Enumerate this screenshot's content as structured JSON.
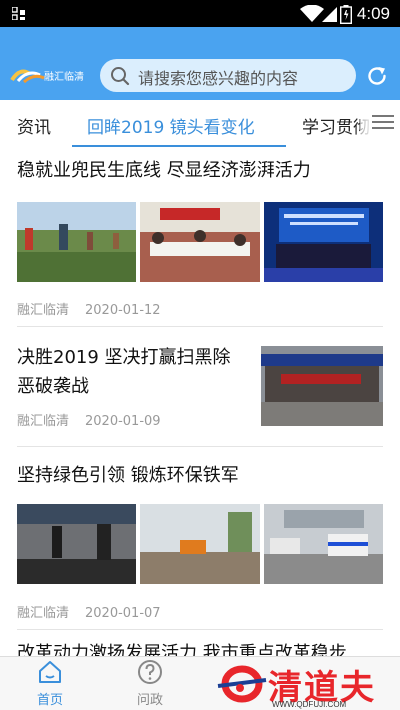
{
  "status_bar": {
    "time": "4:09"
  },
  "header": {
    "logo_text": "融汇临清",
    "search_placeholder": "请搜索您感兴趣的内容"
  },
  "tabs": [
    {
      "label": "资讯"
    },
    {
      "label": "回眸2019 镜头看变化"
    },
    {
      "label": "学习贯彻"
    }
  ],
  "articles": [
    {
      "title": "稳就业兜民生底线 尽显经济澎湃活力",
      "source": "融汇临清",
      "date": "2020-01-12"
    },
    {
      "title_line1": "决胜2019 坚决打赢扫黑除",
      "title_line2": "恶破袭战",
      "source": "融汇临清",
      "date": "2020-01-09"
    },
    {
      "title": "坚持绿色引领 锻炼环保铁军",
      "source": "融汇临清",
      "date": "2020-01-07"
    },
    {
      "title": "改革动力激扬发展活力 我市重点改革稳步"
    }
  ],
  "bottom_nav": [
    {
      "label": "首页",
      "icon": "home-icon"
    },
    {
      "label": "问政",
      "icon": "question-icon"
    }
  ],
  "watermark": {
    "text": "清道夫",
    "url": "WWW.QDFUJI.COM"
  },
  "colors": {
    "accent": "#4aa3f0",
    "tab_active": "#3a8fdb",
    "watermark": "#e8262b"
  }
}
